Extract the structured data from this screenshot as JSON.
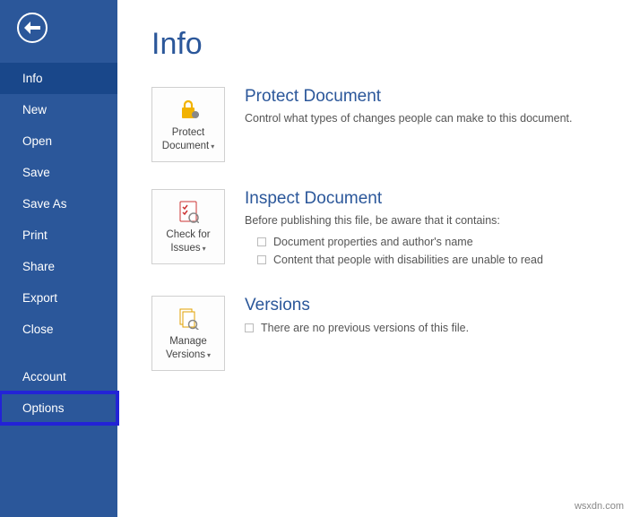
{
  "sidebar": {
    "items": [
      {
        "label": "Info",
        "active": true
      },
      {
        "label": "New"
      },
      {
        "label": "Open"
      },
      {
        "label": "Save"
      },
      {
        "label": "Save As"
      },
      {
        "label": "Print"
      },
      {
        "label": "Share"
      },
      {
        "label": "Export"
      },
      {
        "label": "Close"
      }
    ],
    "footer_items": [
      {
        "label": "Account"
      },
      {
        "label": "Options",
        "highlight": true
      }
    ]
  },
  "page": {
    "title": "Info"
  },
  "sections": {
    "protect": {
      "card_line1": "Protect",
      "card_line2": "Document",
      "title": "Protect Document",
      "desc": "Control what types of changes people can make to this document."
    },
    "inspect": {
      "card_line1": "Check for",
      "card_line2": "Issues",
      "title": "Inspect Document",
      "desc": "Before publishing this file, be aware that it contains:",
      "bullet1": "Document properties and author's name",
      "bullet2": "Content that people with disabilities are unable to read"
    },
    "versions": {
      "card_line1": "Manage",
      "card_line2": "Versions",
      "title": "Versions",
      "desc": "There are no previous versions of this file."
    }
  },
  "attribution": "wsxdn.com"
}
